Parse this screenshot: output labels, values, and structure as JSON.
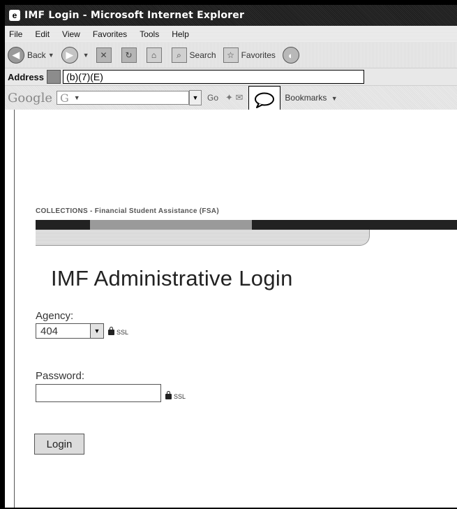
{
  "window": {
    "title": "IMF Login - Microsoft Internet Explorer"
  },
  "menu": [
    "File",
    "Edit",
    "View",
    "Favorites",
    "Tools",
    "Help"
  ],
  "toolbar": {
    "back_label": "Back",
    "search_label": "Search",
    "favorites_label": "Favorites"
  },
  "address": {
    "label": "Address",
    "value": "(b)(7)(E)"
  },
  "google_toolbar": {
    "logo_text": "Google",
    "search_prefix": "G",
    "go_label": "Go",
    "bookmarks_label": "Bookmarks"
  },
  "page": {
    "banner_text": "COLLECTIONS - Financial Student Assistance (FSA)",
    "heading": "IMF Administrative Login",
    "agency_label": "Agency:",
    "agency_value": "404",
    "ssl_text": "SSL",
    "password_label": "Password:",
    "password_value": "",
    "login_label": "Login"
  }
}
